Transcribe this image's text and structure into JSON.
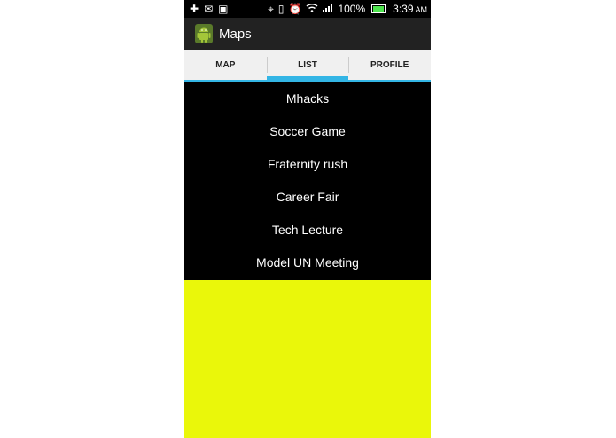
{
  "status_bar": {
    "icons_left": [
      "add-icon",
      "mail-icon",
      "calendar-icon"
    ],
    "icons_right": [
      "location-icon",
      "vibrate-icon",
      "alarm-icon",
      "wifi-icon",
      "signal-icon",
      "battery-icon"
    ],
    "battery_percent": "100%",
    "battery_level": 1.0,
    "time": "3:39",
    "ampm": "AM",
    "colors": {
      "background": "#000000",
      "battery": "#4ee44e"
    }
  },
  "action_bar": {
    "title": "Maps",
    "icon": "android-icon",
    "colors": {
      "background": "#222222",
      "icon": "#a4c639"
    }
  },
  "tabs": {
    "items": [
      {
        "label": "MAP",
        "active": false
      },
      {
        "label": "LIST",
        "active": true
      },
      {
        "label": "PROFILE",
        "active": false
      }
    ],
    "colors": {
      "background": "#f0f0f0",
      "indicator": "#33b5e5"
    }
  },
  "list": {
    "items": [
      "Mhacks",
      "Soccer Game",
      "Fraternity rush",
      "Career Fair",
      "Tech Lecture",
      "Model UN Meeting"
    ]
  },
  "colors": {
    "list_background": "#000000",
    "bottom_area": "#eaf70a"
  }
}
